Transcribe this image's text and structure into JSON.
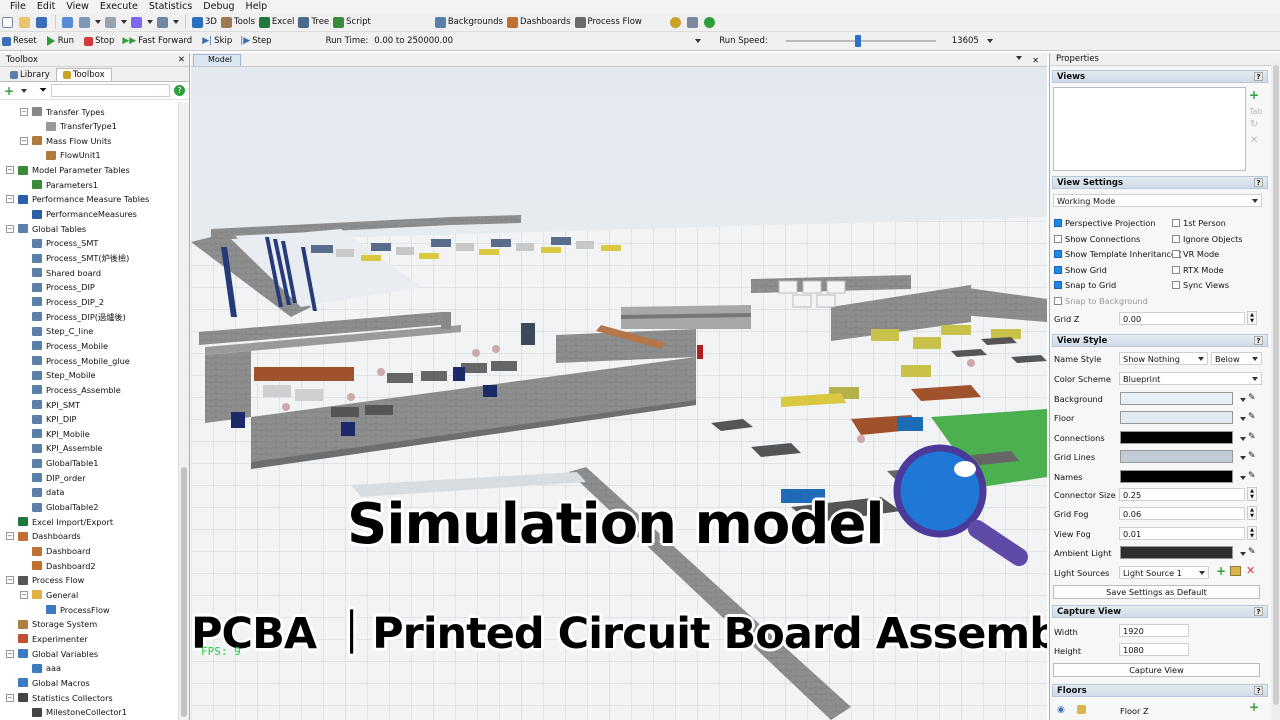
{
  "menu": [
    "File",
    "Edit",
    "View",
    "Execute",
    "Statistics",
    "Debug",
    "Help"
  ],
  "toolbar": {
    "btn_3d": "3D",
    "tools": "Tools",
    "excel": "Excel",
    "tree": "Tree",
    "script": "Script",
    "backgrounds": "Backgrounds",
    "dashboards": "Dashboards",
    "process_flow": "Process Flow"
  },
  "run": {
    "reset": "Reset",
    "run": "Run",
    "stop": "Stop",
    "fast_forward": "Fast Forward",
    "skip": "Skip",
    "step": "Step",
    "run_time_label": "Run Time:",
    "run_time_value": "0.00  to  250000.00",
    "run_speed_label": "Run Speed:",
    "run_speed_value": "13605",
    "run_speed_fraction": 0.48
  },
  "toolbox": {
    "title": "Toolbox",
    "tabs": [
      "Library",
      "Toolbox"
    ],
    "items": [
      {
        "label": "Transfer Types",
        "level": 1,
        "exp": "−",
        "color": "#888"
      },
      {
        "label": "TransferType1",
        "level": 2,
        "exp": "",
        "color": "#999"
      },
      {
        "label": "Mass Flow Units",
        "level": 1,
        "exp": "−",
        "color": "#b07a3a"
      },
      {
        "label": "FlowUnit1",
        "level": 2,
        "exp": "",
        "color": "#b07a3a"
      },
      {
        "label": "Model Parameter Tables",
        "level": 0,
        "exp": "−",
        "color": "#3a8a3a"
      },
      {
        "label": "Parameters1",
        "level": 1,
        "exp": "",
        "color": "#3a8a3a"
      },
      {
        "label": "Performance Measure Tables",
        "level": 0,
        "exp": "−",
        "color": "#2a5fa8"
      },
      {
        "label": "PerformanceMeasures",
        "level": 1,
        "exp": "",
        "color": "#2a5fa8"
      },
      {
        "label": "Global Tables",
        "level": 0,
        "exp": "−",
        "color": "#5a7fa8"
      },
      {
        "label": "Process_SMT",
        "level": 1,
        "exp": "",
        "color": "#5a7fa8"
      },
      {
        "label": "Process_SMT(炉後檢)",
        "level": 1,
        "exp": "",
        "color": "#5a7fa8"
      },
      {
        "label": "Shared board",
        "level": 1,
        "exp": "",
        "color": "#5a7fa8"
      },
      {
        "label": "Process_DIP",
        "level": 1,
        "exp": "",
        "color": "#5a7fa8"
      },
      {
        "label": "Process_DIP_2",
        "level": 1,
        "exp": "",
        "color": "#5a7fa8"
      },
      {
        "label": "Process_DIP(過爐後)",
        "level": 1,
        "exp": "",
        "color": "#5a7fa8"
      },
      {
        "label": "Step_C_line",
        "level": 1,
        "exp": "",
        "color": "#5a7fa8"
      },
      {
        "label": "Process_Mobile",
        "level": 1,
        "exp": "",
        "color": "#5a7fa8"
      },
      {
        "label": "Process_Mobile_glue",
        "level": 1,
        "exp": "",
        "color": "#5a7fa8"
      },
      {
        "label": "Step_Mobile",
        "level": 1,
        "exp": "",
        "color": "#5a7fa8"
      },
      {
        "label": "Process_Assemble",
        "level": 1,
        "exp": "",
        "color": "#5a7fa8"
      },
      {
        "label": "KPI_SMT",
        "level": 1,
        "exp": "",
        "color": "#5a7fa8"
      },
      {
        "label": "KPI_DIP",
        "level": 1,
        "exp": "",
        "color": "#5a7fa8"
      },
      {
        "label": "KPI_Mobile",
        "level": 1,
        "exp": "",
        "color": "#5a7fa8"
      },
      {
        "label": "KPI_Assemble",
        "level": 1,
        "exp": "",
        "color": "#5a7fa8"
      },
      {
        "label": "GlobalTable1",
        "level": 1,
        "exp": "",
        "color": "#5a7fa8"
      },
      {
        "label": "DIP_order",
        "level": 1,
        "exp": "",
        "color": "#5a7fa8"
      },
      {
        "label": "data",
        "level": 1,
        "exp": "",
        "color": "#5a7fa8"
      },
      {
        "label": "GlobalTable2",
        "level": 1,
        "exp": "",
        "color": "#5a7fa8"
      },
      {
        "label": "Excel Import/Export",
        "level": 0,
        "exp": "",
        "color": "#1e7a3c"
      },
      {
        "label": "Dashboards",
        "level": 0,
        "exp": "−",
        "color": "#c07030"
      },
      {
        "label": "Dashboard",
        "level": 1,
        "exp": "",
        "color": "#c07030"
      },
      {
        "label": "Dashboard2",
        "level": 1,
        "exp": "",
        "color": "#c07030"
      },
      {
        "label": "Process Flow",
        "level": 0,
        "exp": "−",
        "color": "#555"
      },
      {
        "label": "General",
        "level": 1,
        "exp": "−",
        "color": "#e0b040"
      },
      {
        "label": "ProcessFlow",
        "level": 2,
        "exp": "",
        "color": "#3a7ac0"
      },
      {
        "label": "Storage System",
        "level": 0,
        "exp": "",
        "color": "#b08040"
      },
      {
        "label": "Experimenter",
        "level": 0,
        "exp": "",
        "color": "#c05030"
      },
      {
        "label": "Global Variables",
        "level": 0,
        "exp": "−",
        "color": "#3a7ac0"
      },
      {
        "label": "aaa",
        "level": 1,
        "exp": "",
        "color": "#3a7ac0"
      },
      {
        "label": "Global Macros",
        "level": 0,
        "exp": "",
        "color": "#3a7ac0"
      },
      {
        "label": "Statistics Collectors",
        "level": 0,
        "exp": "−",
        "color": "#444"
      },
      {
        "label": "MilestoneCollector1",
        "level": 1,
        "exp": "",
        "color": "#444"
      }
    ]
  },
  "model": {
    "tab": "Model",
    "title_overlay": "Simulation model",
    "subtitle_overlay": "PCBA ｜Printed Circuit Board Assembly",
    "fps": "FPS: 9"
  },
  "properties": {
    "title": "Properties",
    "views_header": "Views",
    "view_settings_header": "View Settings",
    "working_mode": "Working Mode",
    "checks_left": [
      {
        "label": "Perspective Projection",
        "on": true
      },
      {
        "label": "Show Connections",
        "on": false
      },
      {
        "label": "Show Template Inheritance (",
        "on": true
      },
      {
        "label": "Show Grid",
        "on": true
      },
      {
        "label": "Snap to Grid",
        "on": true
      },
      {
        "label": "Snap to Background",
        "on": false
      }
    ],
    "checks_right": [
      {
        "label": "1st Person",
        "on": false
      },
      {
        "label": "Ignore Objects",
        "on": false
      },
      {
        "label": "VR Mode",
        "on": false
      },
      {
        "label": "RTX Mode",
        "on": false
      },
      {
        "label": "Sync Views",
        "on": false
      }
    ],
    "grid_z_label": "Grid Z",
    "grid_z_value": "0.00",
    "view_style_header": "View Style",
    "name_style_label": "Name Style",
    "name_style_value": "Show Nothing",
    "name_style_pos": "Below",
    "color_scheme_label": "Color Scheme",
    "color_scheme_value": "Blueprint",
    "colors": [
      {
        "label": "Background",
        "color": "#e8eef6"
      },
      {
        "label": "Floor",
        "color": "#e2e8f0"
      },
      {
        "label": "Connections",
        "color": "#000000"
      },
      {
        "label": "Grid Lines",
        "color": "#c3cbd6"
      },
      {
        "label": "Names",
        "color": "#000000"
      }
    ],
    "connector_size_label": "Connector Size",
    "connector_size_value": "0.25",
    "grid_fog_label": "Grid Fog",
    "grid_fog_value": "0.06",
    "view_fog_label": "View Fog",
    "view_fog_value": "0.01",
    "ambient_light_label": "Ambient Light",
    "ambient_light_color": "#2e2e2e",
    "light_sources_label": "Light Sources",
    "light_sources_value": "Light Source 1",
    "save_default": "Save Settings as Default",
    "capture_view_header": "Capture View",
    "width_label": "Width",
    "width_value": "1920",
    "height_label": "Height",
    "height_value": "1080",
    "capture_button": "Capture View",
    "floors_header": "Floors",
    "floor_label": "Floor Z",
    "help_glyph": "?"
  }
}
